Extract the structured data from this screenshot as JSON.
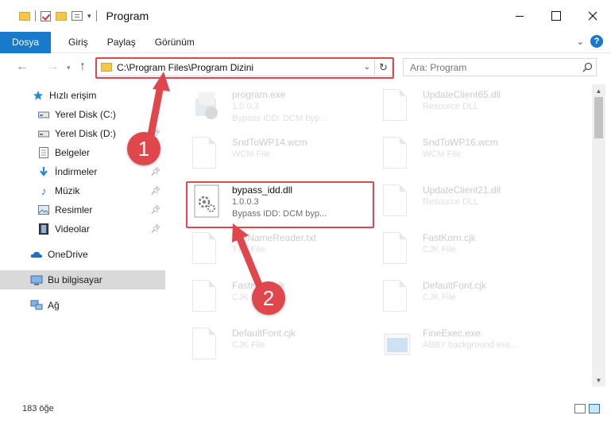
{
  "window": {
    "title": "Program"
  },
  "ribbon": {
    "tabs": [
      "Dosya",
      "Giriş",
      "Paylaş",
      "Görünüm"
    ]
  },
  "nav": {
    "address": "C:\\Program Files\\Program Dizini",
    "search_placeholder": "Ara: Program"
  },
  "sidebar": {
    "items": [
      {
        "label": "Hızlı erişim",
        "icon": "star-icon"
      },
      {
        "label": "Yerel Disk (C:)",
        "icon": "drive-icon",
        "pinned": true
      },
      {
        "label": "Yerel Disk (D:)",
        "icon": "drive-icon",
        "pinned": true
      },
      {
        "label": "Belgeler",
        "icon": "documents-icon",
        "pinned": true
      },
      {
        "label": "İndirmeler",
        "icon": "download-icon",
        "pinned": true
      },
      {
        "label": "Müzik",
        "icon": "music-icon",
        "pinned": true
      },
      {
        "label": "Resimler",
        "icon": "pictures-icon",
        "pinned": true
      },
      {
        "label": "Videolar",
        "icon": "videos-icon",
        "pinned": true
      },
      {
        "label": "OneDrive",
        "icon": "cloud-icon"
      },
      {
        "label": "Bu bilgisayar",
        "icon": "computer-icon",
        "selected": true
      },
      {
        "label": "Ağ",
        "icon": "network-icon"
      }
    ]
  },
  "files": [
    {
      "name": "program.exe",
      "sub1": "1.0.0.3",
      "sub2": "Bypass IDD: DCM byp...",
      "faded": true
    },
    {
      "name": "UpdateClient65.dll",
      "sub1": "Resource DLL",
      "sub2": "",
      "faded": true
    },
    {
      "name": "SndToWP14.wcm",
      "sub1": "WCM File",
      "sub2": "",
      "faded": true
    },
    {
      "name": "SndToWP16.wcm",
      "sub1": "WCM File",
      "sub2": "",
      "faded": true
    },
    {
      "name": "bypass_idd.dll",
      "sub1": "1.0.0.3",
      "sub2": "Bypass IDD: DCM byp...",
      "faded": false
    },
    {
      "name": "UpdateClient21.dll",
      "sub1": "Resource DLL",
      "sub2": "",
      "faded": true
    },
    {
      "name": "FileNameReader.txt",
      "sub1": "TXT File",
      "sub2": "",
      "faded": true
    },
    {
      "name": "FastKorn.cjk",
      "sub1": "CJK File",
      "sub2": "",
      "faded": true
    },
    {
      "name": "FastKorn.cjk",
      "sub1": "CJK File",
      "sub2": "",
      "faded": true
    },
    {
      "name": "DefaultFont.cjk",
      "sub1": "CJK File",
      "sub2": "",
      "faded": true
    },
    {
      "name": "DefaultFont.cjk",
      "sub1": "CJK File",
      "sub2": "",
      "faded": true
    },
    {
      "name": "FineExec.exe",
      "sub1": "ABBY background exe...",
      "sub2": "",
      "faded": true
    }
  ],
  "status": {
    "item_count": "183 öğe"
  },
  "callouts": [
    "1",
    "2"
  ],
  "colors": {
    "accent": "#1979ca",
    "highlight": "#e0474c",
    "folder": "#f3c84a"
  }
}
